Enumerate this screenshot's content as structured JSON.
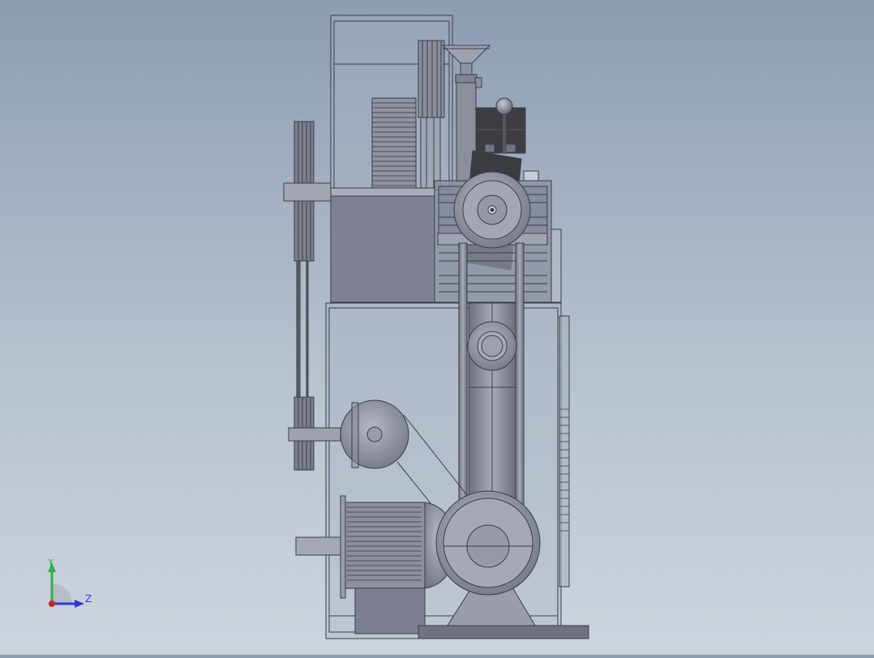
{
  "viewport": {
    "model": "press-machine-side-view",
    "colors": {
      "background_top": "#8c9db2",
      "background_bottom": "#cdd4de",
      "frame_line": "#3b3d4a",
      "body_fill": "#7d8192",
      "dark_part": "#3a3a3e",
      "metal": "#9a9ead"
    }
  },
  "triad": {
    "y_label": "Y",
    "z_label": "Z",
    "y_color": "#2db34a",
    "z_color": "#2c3bd6",
    "origin_color": "#d11f1f"
  }
}
